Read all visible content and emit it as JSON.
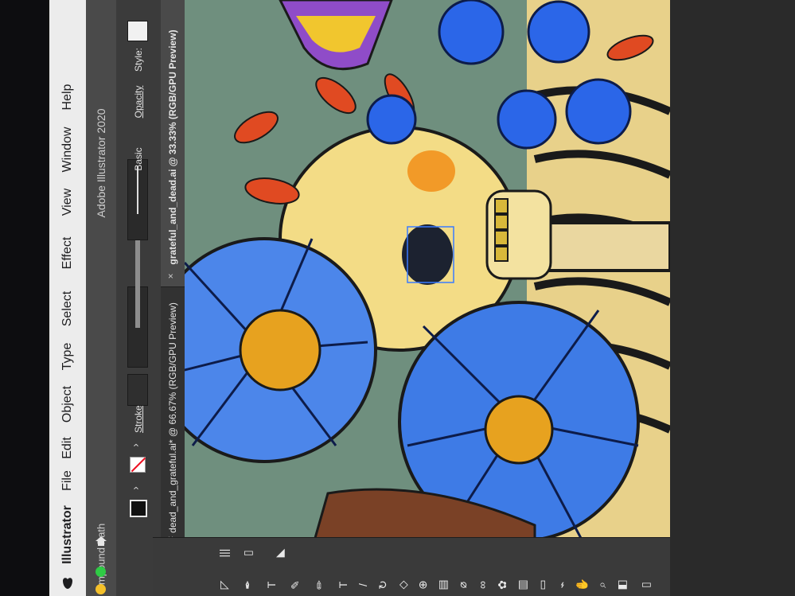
{
  "menubar": {
    "app_name": "Illustrator",
    "items": [
      "File",
      "Edit",
      "Object",
      "Type",
      "Select",
      "Effect",
      "View",
      "Window",
      "Help"
    ]
  },
  "titlebar": {
    "title": "Adobe Illustrator 2020",
    "side_label": "ompound Path"
  },
  "controlbar": {
    "stroke_label": "Stroke:",
    "brush_label": "Basic",
    "opacity_label": "Opacity",
    "style_label": "Style:"
  },
  "tabs": [
    {
      "label": "dead_and_grateful.ai* @ 66.67% (RGB/GPU Preview)",
      "active": false
    },
    {
      "label": "grateful_and_dead.ai @ 33.33% (RGB/GPU Preview)",
      "active": true
    }
  ],
  "artwork": {
    "colors": {
      "background": "#6f8f7e",
      "skull": "#f3dc86",
      "skeleton": "#e8d18a",
      "blue_flower": "#2b66e8",
      "red_leaf": "#e04a22",
      "selection": "#3a7bff"
    }
  },
  "tools": [
    "direct-selection-icon",
    "pen-icon",
    "type-icon",
    "brush-icon",
    "pencil-icon",
    "type-tool-icon",
    "line-icon",
    "rotate-icon",
    "eraser-icon",
    "shape-builder-icon",
    "gradient-icon",
    "eyedropper-icon",
    "blend-icon",
    "symbol-icon",
    "graph-icon",
    "artboard-icon",
    "slice-icon",
    "hand-icon",
    "zoom-icon",
    "fill-stroke-icon"
  ]
}
